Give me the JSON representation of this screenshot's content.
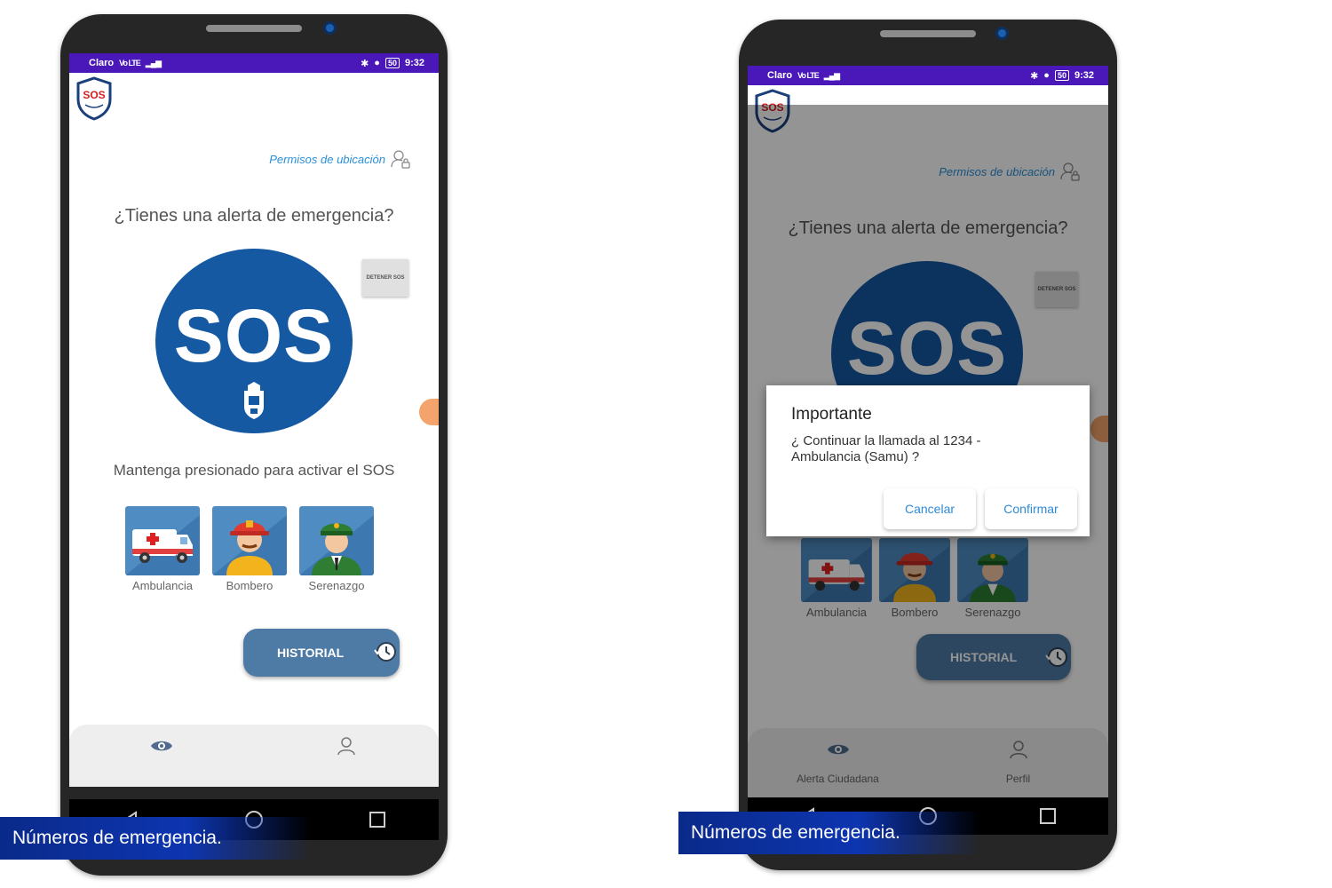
{
  "status_bar": {
    "carrier": "Claro",
    "network": "Vo LTE",
    "battery": "50",
    "time": "9:32"
  },
  "app": {
    "logo_text": "SOS",
    "permissions_link": "Permisos de ubicación",
    "question": "¿Tienes una alerta de emergencia?",
    "stop_button": "DETENER SOS",
    "sos_button": "SOS",
    "hint": "Mantenga presionado para activar el SOS",
    "services": [
      {
        "label": "Ambulancia",
        "icon": "ambulance-icon"
      },
      {
        "label": "Bombero",
        "icon": "firefighter-icon"
      },
      {
        "label": "Serenazgo",
        "icon": "officer-icon"
      }
    ],
    "history_button": "HISTORIAL",
    "bottom_nav": [
      {
        "label": "Alerta Ciudadana",
        "icon": "eye-icon"
      },
      {
        "label": "Perfil",
        "icon": "user-icon"
      }
    ]
  },
  "dialog": {
    "title": "Importante",
    "message": "¿ Continuar la llamada al 1234 - Ambulancia (Samu) ?",
    "cancel": "Cancelar",
    "confirm": "Confirmar"
  },
  "caption": "Números de emergencia.",
  "colors": {
    "status_bar": "#4a18b8",
    "sos_blue": "#1559a3",
    "tile_blue": "#4f8cc2",
    "history_button": "#4e7aa6",
    "link_blue": "#2a8fd9",
    "caption_blue": "#0d35b0"
  }
}
